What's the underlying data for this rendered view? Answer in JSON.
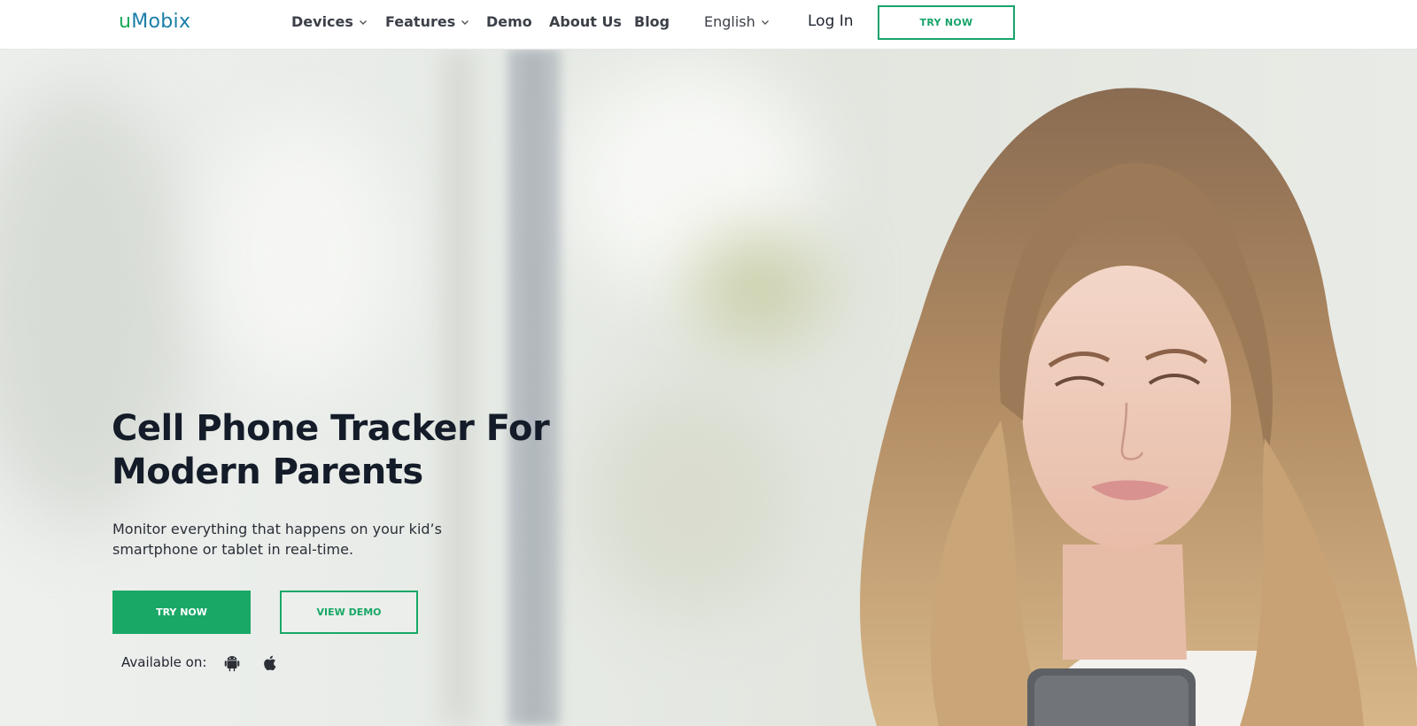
{
  "header": {
    "logo_u": "u",
    "logo_rest": "Mobix",
    "nav": {
      "devices": "Devices",
      "features": "Features",
      "demo": "Demo",
      "about": "About Us",
      "blog": "Blog"
    },
    "language": "English",
    "login": "Log In",
    "try_now": "TRY NOW"
  },
  "hero": {
    "headline": "Cell Phone Tracker For Modern Parents",
    "subtext": "Monitor everything that happens on your kid’s smartphone or tablet in real-time.",
    "try_now": "TRY NOW",
    "view_demo": "VIEW DEMO",
    "available_on": "Available on:",
    "platform_icons": [
      "android-icon",
      "apple-icon"
    ]
  },
  "colors": {
    "brand_green": "#19a866",
    "logo_blue": "#1a7fa8",
    "heading": "#141c29"
  }
}
